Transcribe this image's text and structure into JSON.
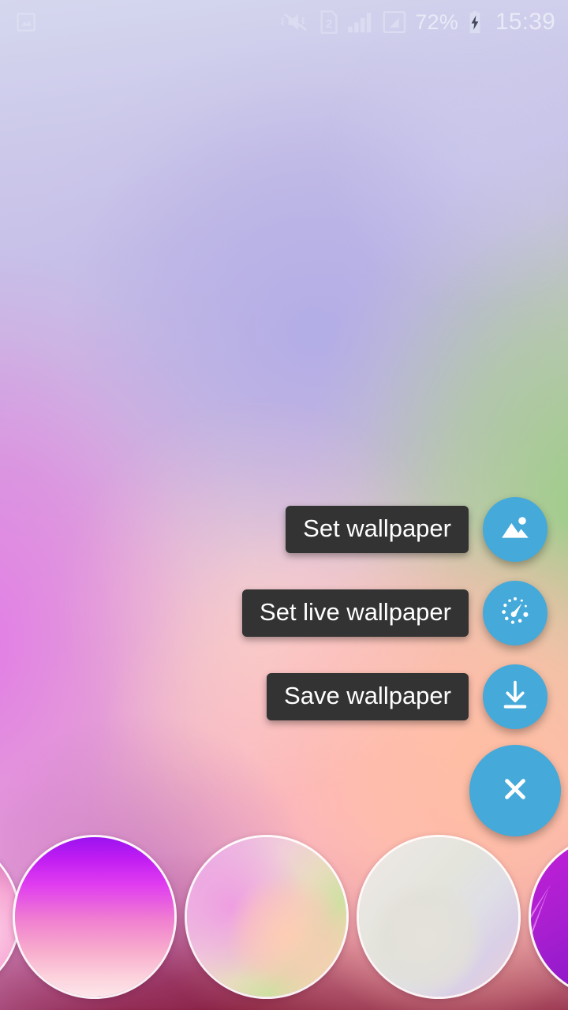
{
  "status_bar": {
    "notification_icon": "image-notification-icon",
    "icons": [
      {
        "name": "vibrate-mute-icon",
        "label": "Silent"
      },
      {
        "name": "sim2-icon",
        "label": "2"
      },
      {
        "name": "signal-bars-sim1-icon",
        "label": "Signal 1"
      },
      {
        "name": "signal-bars-sim2-icon",
        "label": "Signal 2"
      }
    ],
    "battery_percent": "72%",
    "battery_charging_icon": "battery-charging-bolt-icon",
    "time": "15:39"
  },
  "fab_menu": {
    "accent_color": "#45a9da",
    "label_background": "#333333",
    "label_text_color": "#ffffff",
    "actions": [
      {
        "label": "Set wallpaper",
        "icon": "image-icon",
        "name": "set-wallpaper"
      },
      {
        "label": "Set live wallpaper",
        "icon": "live-gauge-icon",
        "name": "set-live-wallpaper"
      },
      {
        "label": "Save wallpaper",
        "icon": "download-icon",
        "name": "save-wallpaper"
      }
    ],
    "close": {
      "label": "Close",
      "icon": "close-x-icon",
      "name": "close-menu"
    }
  },
  "carousel": {
    "items": [
      {
        "name": "wallpaper-thumb-0",
        "partial": true
      },
      {
        "name": "wallpaper-thumb-1",
        "partial": false
      },
      {
        "name": "wallpaper-thumb-2",
        "partial": false
      },
      {
        "name": "wallpaper-thumb-3",
        "partial": false
      },
      {
        "name": "wallpaper-thumb-4",
        "partial": true
      }
    ]
  },
  "wallpaper_preview": {
    "name": "wallpaper-preview"
  }
}
